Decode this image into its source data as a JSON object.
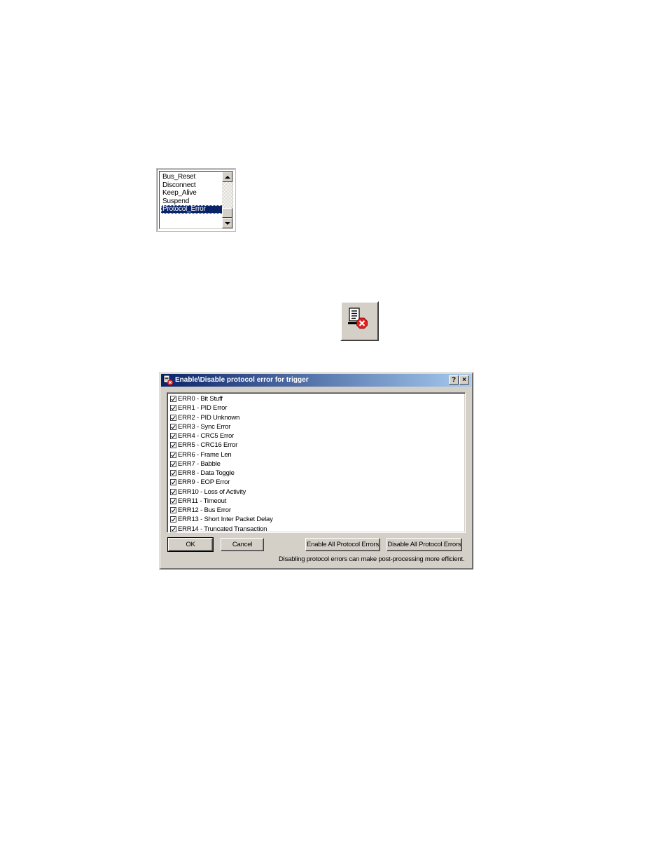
{
  "event_list": {
    "items": [
      "Bus_Reset",
      "Disconnect",
      "Keep_Alive",
      "Suspend",
      "Protocol_Error",
      "",
      ""
    ],
    "selected": "Protocol_Error"
  },
  "toolbar_icon": {
    "name": "protocol-error-filter-icon"
  },
  "dialog": {
    "title": "Enable\\Disable  protocol error for trigger",
    "help_label": "?",
    "close_label": "×",
    "errors": [
      {
        "label": "ERR0 - Bit Stuff",
        "checked": true
      },
      {
        "label": "ERR1 - PID Error",
        "checked": true
      },
      {
        "label": "ERR2 - PID Unknown",
        "checked": true
      },
      {
        "label": "ERR3 - Sync Error",
        "checked": true
      },
      {
        "label": "ERR4 - CRC5 Error",
        "checked": true
      },
      {
        "label": "ERR5 - CRC16 Error",
        "checked": true
      },
      {
        "label": "ERR6 - Frame Len",
        "checked": true
      },
      {
        "label": "ERR7 - Babble",
        "checked": true
      },
      {
        "label": "ERR8 - Data Toggle",
        "checked": true
      },
      {
        "label": "ERR9 - EOP Error",
        "checked": true
      },
      {
        "label": "ERR10 - Loss of Activity",
        "checked": true
      },
      {
        "label": "ERR11 - Timeout",
        "checked": true
      },
      {
        "label": "ERR12 - Bus Error",
        "checked": true
      },
      {
        "label": "ERR13 - Short Inter Packet Delay",
        "checked": true
      },
      {
        "label": "ERR14 - Truncated Transaction",
        "checked": true
      }
    ],
    "buttons": {
      "ok": "OK",
      "cancel": "Cancel",
      "enable_all": "Enable All Protocol Errors",
      "disable_all": "Disable All Protocol Errors"
    },
    "hint": "Disabling protocol errors can make post-processing more efficient."
  },
  "colors": {
    "title_start": "#0a246a",
    "title_end": "#a6caf0",
    "face": "#d4d0c8",
    "selection": "#0a246a",
    "error_red": "#e02020"
  }
}
